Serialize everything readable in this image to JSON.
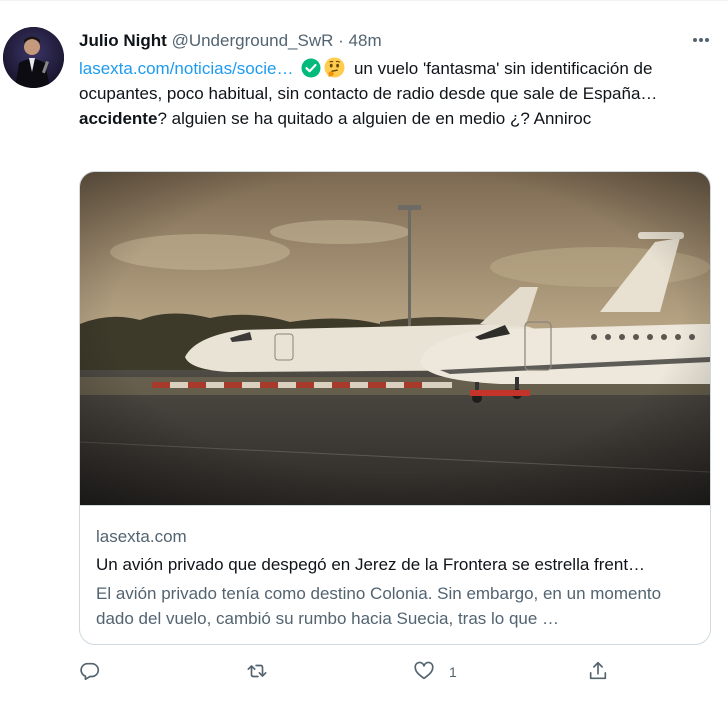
{
  "tweet": {
    "author_name": "Julio Night",
    "handle": "@Underground_SwR",
    "separator": "·",
    "time": "48m",
    "text": {
      "link": "lasexta.com/noticias/socie…",
      "part1": " un vuelo 'fantasma' sin identificación de ocupantes, poco habitual, sin contacto de radio desde que sale de España… ",
      "bold": "accidente",
      "part2": "? alguien se ha quitado a alguien de en medio ¿? Anniroc"
    },
    "icons": {
      "verified": "check-circle-icon",
      "emoji": "thinking-face-emoji",
      "more": "more-dots-icon"
    }
  },
  "card": {
    "domain": "lasexta.com",
    "title": "Un avión privado que despegó en Jerez de la Frontera se estrella frent…",
    "description": "El avión privado tenía como destino Colonia. Sin embargo, en un momento dado del vuelo, cambió su rumbo hacia Suecia, tras lo que …",
    "image": "private-jets-on-tarmac-photo"
  },
  "actions": {
    "reply_icon": "reply-icon",
    "retweet_icon": "retweet-icon",
    "like_icon": "heart-icon",
    "like_count": "1",
    "share_icon": "share-icon"
  },
  "colors": {
    "link": "#1d9bf0",
    "secondary": "#536471",
    "verified": "#00ba7c",
    "border": "#cfd9de"
  }
}
